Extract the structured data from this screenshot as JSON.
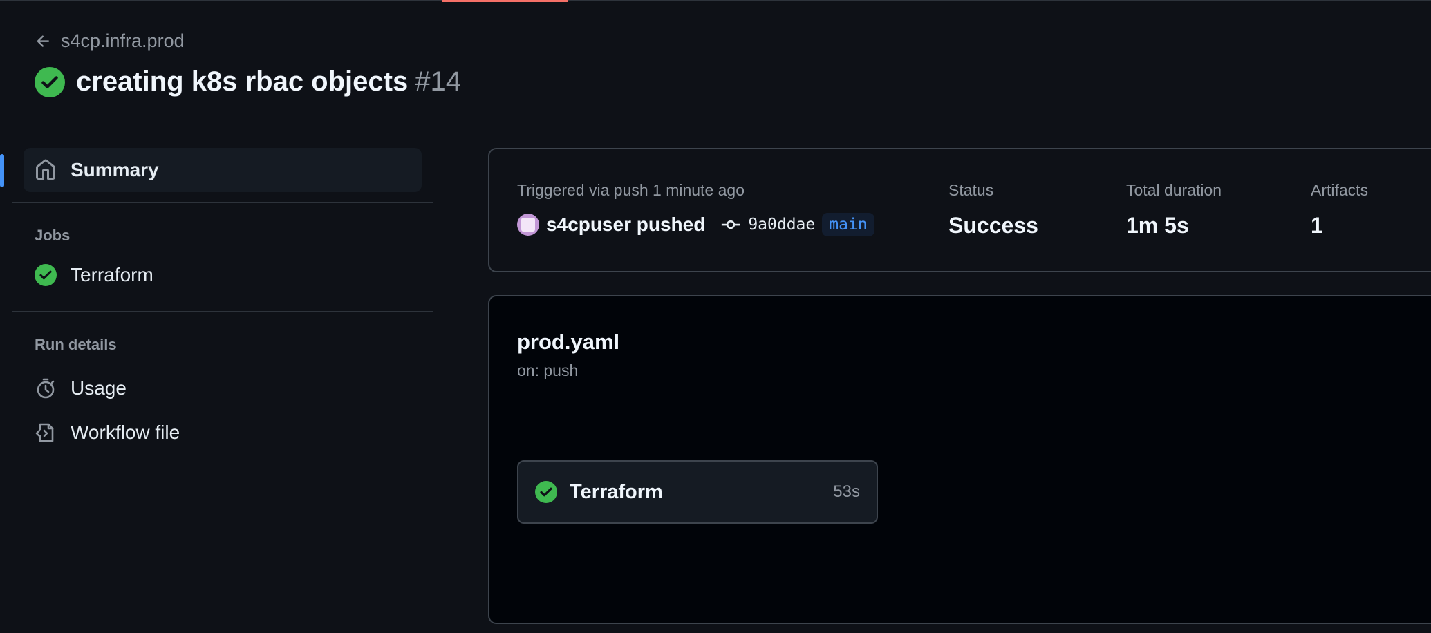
{
  "colors": {
    "success": "#3fb950",
    "accent_blue": "#4493f8",
    "background": "#0e1117",
    "top_accent": "#f47067"
  },
  "header": {
    "back_label": "s4cp.infra.prod",
    "title": "creating k8s rbac objects",
    "run_number": "#14",
    "status_icon": "check-circle-fill-icon"
  },
  "sidebar": {
    "summary_label": "Summary",
    "jobs_heading": "Jobs",
    "jobs": [
      {
        "label": "Terraform",
        "icon": "check-circle-fill-icon"
      }
    ],
    "run_details_heading": "Run details",
    "run_details": [
      {
        "label": "Usage",
        "icon": "stopwatch-icon"
      },
      {
        "label": "Workflow file",
        "icon": "file-code-icon"
      }
    ]
  },
  "summary": {
    "trigger_text": "Triggered via push 1 minute ago",
    "user": "s4cpuser",
    "action": "pushed",
    "commit_sha": "9a0ddae",
    "branch": "main",
    "status_label": "Status",
    "status_value": "Success",
    "duration_label": "Total duration",
    "duration_value": "1m 5s",
    "artifacts_label": "Artifacts",
    "artifacts_value": "1"
  },
  "workflow": {
    "file": "prod.yaml",
    "trigger": "on: push",
    "jobs": [
      {
        "name": "Terraform",
        "duration": "53s"
      }
    ]
  }
}
